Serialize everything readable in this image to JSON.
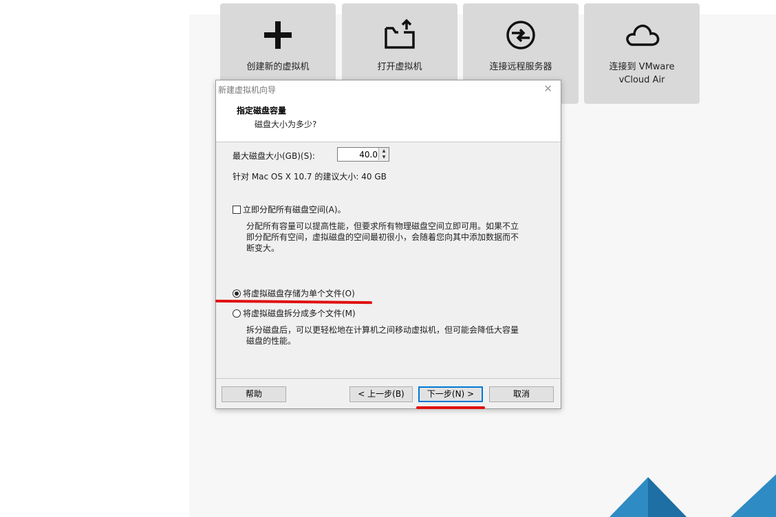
{
  "home": {
    "tiles": [
      {
        "label": "创建新的虚拟机",
        "icon": "plus-icon"
      },
      {
        "label": "打开虚拟机",
        "icon": "open-folder-icon"
      },
      {
        "label": "连接远程服务器",
        "icon": "remote-server-icon"
      },
      {
        "label": "连接到 VMware\nvCloud Air",
        "icon": "cloud-icon"
      }
    ]
  },
  "dialog": {
    "title": "新建虚拟机向导",
    "close": "✕",
    "heading": "指定磁盘容量",
    "subheading": "磁盘大小为多少?",
    "max_size_label": "最大磁盘大小(GB)(S):",
    "max_size_value": "40.0",
    "recommended": "针对 Mac OS X 10.7 的建议大小: 40 GB",
    "allocate_label": "立即分配所有磁盘空间(A)。",
    "allocate_checked": false,
    "allocate_desc": "分配所有容量可以提高性能，但要求所有物理磁盘空间立即可用。如果不立\n即分配所有空间，虚拟磁盘的空间最初很小，会随着您向其中添加数据而不\n断变大。",
    "single_file_label": "将虚拟磁盘存储为单个文件(O)",
    "single_file_selected": true,
    "multi_file_label": "将虚拟磁盘拆分成多个文件(M)",
    "multi_file_desc": "拆分磁盘后，可以更轻松地在计算机之间移动虚拟机，但可能会降低大容量\n磁盘的性能。",
    "buttons": {
      "help": "帮助",
      "back": "< 上一步(B)",
      "next": "下一步(N) >",
      "cancel": "取消"
    }
  },
  "colors": {
    "accent": "#0078d7",
    "annotation_red": "#e01010",
    "logo_blue": "#2f8bc4"
  }
}
